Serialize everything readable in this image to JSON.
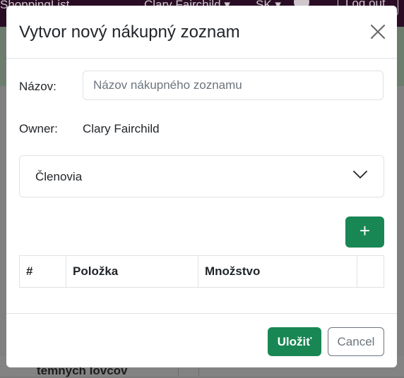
{
  "background": {
    "brand": "ShoppingList",
    "user": "Clary Fairchild ▾",
    "lang": "SK ▾",
    "logout": "Log out",
    "card_text": "temných lovcov"
  },
  "modal": {
    "title": "Vytvor nový nákupný zoznam",
    "close_icon": "close-icon",
    "name_label": "Názov:",
    "name_value": "",
    "name_placeholder": "Názov nákupného zoznamu",
    "owner_label": "Owner:",
    "owner_value": "Clary Fairchild",
    "members_label": "Členovia",
    "members_icon": "chevron-down-icon",
    "add_label": "+",
    "table": {
      "headers": [
        "#",
        "Položka",
        "Množstvo",
        ""
      ]
    },
    "save_label": "Uložiť",
    "cancel_label": "Cancel"
  },
  "colors": {
    "primary_green": "#198754",
    "nav_bg": "#2a0d24",
    "border": "#dee2e6"
  }
}
